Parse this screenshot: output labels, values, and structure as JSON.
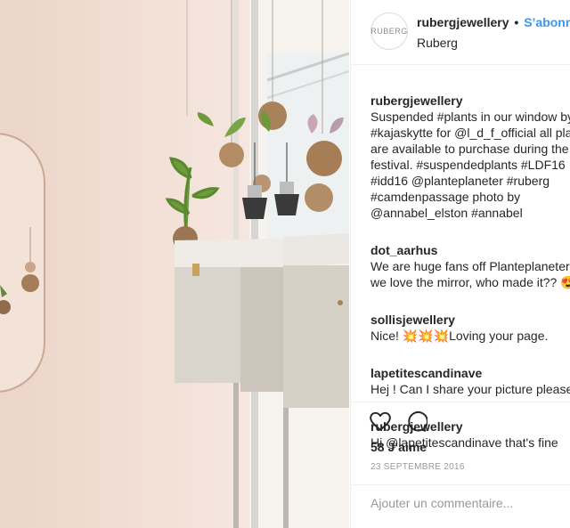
{
  "header": {
    "avatar_text": "RUBERG",
    "username": "rubergjewellery",
    "dot": "•",
    "follow": "S’abonner",
    "location": "Ruberg"
  },
  "comments": [
    {
      "user": "rubergjewellery",
      "text": "Suspended #plants in our window by #kajaskytte for @l_d_f_official all plants are available to purchase during the festival. #suspendedplants #LDF16 #idd16 @planteplaneter #ruberg #camdenpassage photo by @annabel_elston #annabel"
    },
    {
      "user": "dot_aarhus",
      "text": "We are huge fans off Planteplaneter.. And we love the mirror, who made it?? 😍"
    },
    {
      "user": "sollisjewellery",
      "text": "Nice! 💥💥💥Loving your page."
    },
    {
      "user": "lapetitescandinave",
      "text": "Hej ! Can I share your picture please ?"
    },
    {
      "user": "rubergjewellery",
      "text": "Hi @lapetitescandinave that's fine"
    }
  ],
  "actions": {
    "like_icon": "heart-icon",
    "comment_icon": "comment-bubble-icon"
  },
  "likes": "58 J’aime",
  "date": "23 SEPTEMBRE 2016",
  "add_comment_placeholder": "Ajouter un commentaire...",
  "colors": {
    "link": "#003569",
    "follow": "#3897f0",
    "muted": "#999999"
  }
}
